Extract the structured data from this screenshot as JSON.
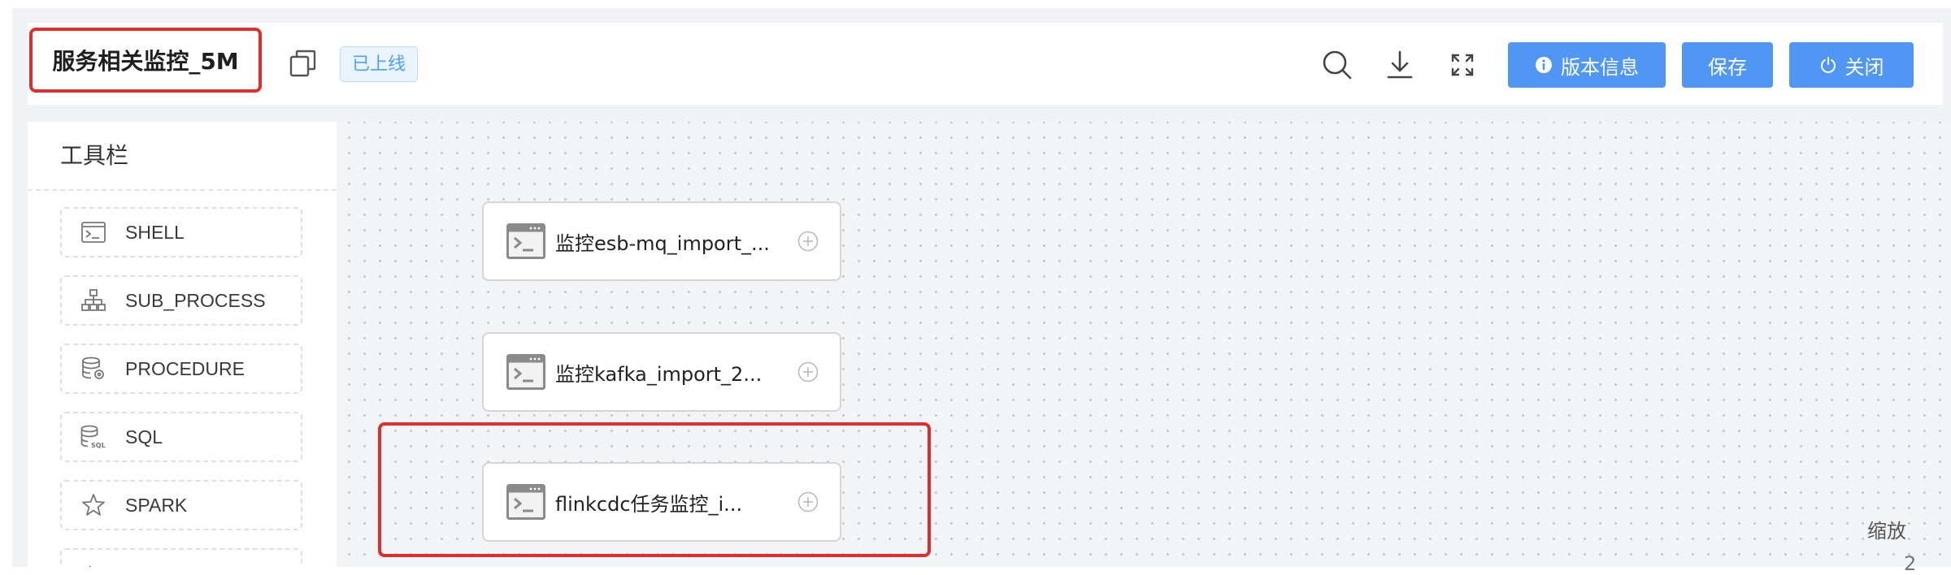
{
  "header": {
    "title": "服务相关监控_5M",
    "status_badge": "已上线",
    "buttons": {
      "version_info": "版本信息",
      "save": "保存",
      "close": "关闭"
    },
    "icons": [
      "copy-icon",
      "search-icon",
      "download-icon",
      "fullscreen-icon",
      "info-icon",
      "power-icon"
    ],
    "colors": {
      "primary": "#4f97f2",
      "highlight": "#e02d2d",
      "badge_text": "#4ea2f5"
    }
  },
  "toolbar": {
    "title": "工具栏",
    "items": [
      {
        "label": "SHELL",
        "icon": "terminal-icon"
      },
      {
        "label": "SUB_PROCESS",
        "icon": "sitemap-icon"
      },
      {
        "label": "PROCEDURE",
        "icon": "database-gear-icon"
      },
      {
        "label": "SQL",
        "icon": "database-sql-icon"
      },
      {
        "label": "SPARK",
        "icon": "star-icon"
      }
    ]
  },
  "canvas": {
    "nodes": [
      {
        "label": "监控esb-mq_import_...",
        "icon": "terminal-icon"
      },
      {
        "label": "监控kafka_import_2...",
        "icon": "terminal-icon"
      },
      {
        "label": "flinkcdc任务监控_i...",
        "icon": "terminal-icon",
        "highlighted": true
      }
    ],
    "zoom_label": "缩放",
    "zoom_value": "2"
  }
}
